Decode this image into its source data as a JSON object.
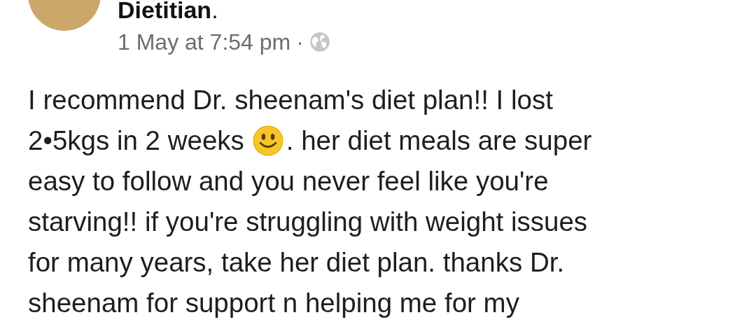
{
  "post": {
    "author": "**Dietitian**.",
    "time": "1 May at 7:54 pm",
    "separator": "·",
    "lines": [
      [
        {
          "kind": "text",
          "text": "I recommend Dr. sheenam's diet plan!! I lost"
        }
      ],
      [
        {
          "kind": "text",
          "text": "2•5kgs in 2 weeks"
        },
        {
          "kind": "smiley"
        },
        {
          "kind": "text",
          "text": ". her diet meals are super"
        }
      ],
      [
        {
          "kind": "text",
          "text": "easy to follow and you never feel like you're"
        }
      ],
      [
        {
          "kind": "text",
          "text": "starving!! if you're struggling with weight issues"
        }
      ],
      [
        {
          "kind": "text",
          "text": "for many years, take her diet plan. thanks Dr."
        }
      ],
      [
        {
          "kind": "text",
          "text": "sheenam for support n helping me for my"
        }
      ]
    ]
  }
}
